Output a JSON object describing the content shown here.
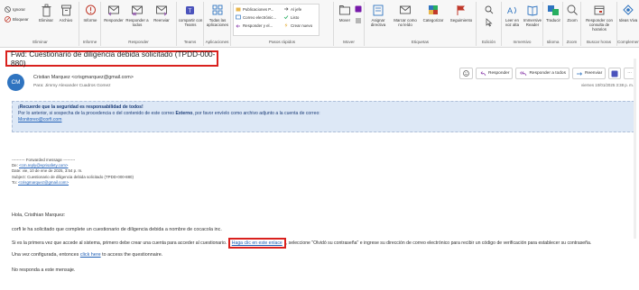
{
  "ribbon": {
    "groups": [
      {
        "label": "Eliminar",
        "buttons": [
          "Ignorar",
          "Bloquear",
          "Eliminar",
          "Archivo"
        ]
      },
      {
        "label": "Informe",
        "buttons": [
          "Informe"
        ]
      },
      {
        "label": "Responder",
        "buttons": [
          "Responder",
          "Responder a todos",
          "Reenviar"
        ]
      },
      {
        "label": "Teams",
        "buttons": [
          "compartir con Teams"
        ]
      },
      {
        "label": "Aplicaciones",
        "buttons": [
          "Todas las aplicaciones"
        ]
      },
      {
        "label": "Pasos rápidos",
        "buttons": [
          "Publicaciones P...",
          "Correo electrónic...",
          "Responder y el...",
          "Al jefe",
          "Listo",
          "Crear nuevo"
        ]
      },
      {
        "label": "Mover",
        "buttons": [
          "Mover"
        ]
      },
      {
        "label": "Etiquetas",
        "buttons": [
          "Asignar directiva",
          "Marcar como no leído",
          "Categorizar",
          "Seguimiento"
        ]
      },
      {
        "label": "Edición",
        "buttons": []
      },
      {
        "label": "Inmersivo",
        "buttons": [
          "Leer en voz alta",
          "Immersive Reader"
        ]
      },
      {
        "label": "Idioma",
        "buttons": [
          "Traducir"
        ]
      },
      {
        "label": "Zoom",
        "buttons": [
          "Zoom"
        ]
      },
      {
        "label": "Buscar horas",
        "buttons": [
          "Responder con consulta de horarios"
        ]
      },
      {
        "label": "Complemento",
        "buttons": [
          "Ideas Viva"
        ]
      }
    ]
  },
  "email": {
    "subject": "Fwd: Cuestionario de diligencia debida solicitado (TPDD-000-880)",
    "avatar_initials": "CM",
    "from": "Cristian Marquez <crisgmarquez@gmail.com>",
    "to": "Para: Jimmy Alexander Cuadros Gomez",
    "date": "viernes 10/01/2025 3:38 p. m.",
    "actions": {
      "reply": "Responder",
      "reply_all": "Responder a todos",
      "forward": "Reenviar"
    },
    "banner": {
      "line1": "¡Recuerde que la seguridad es responsabilidad de todos!",
      "line2_pre": "Por lo anterior, si sospecha de la procedencia o del contenido de este correo ",
      "line2_bold": "Externo",
      "line2_post": ", por favor envíelo como archivo adjunto a la cuenta de correo:",
      "link": "Monitoreo@corfi.com"
    },
    "forwarded": {
      "header": "---------- Forwarded message ---------",
      "from_label": "De: ",
      "from_value": "<cm.reply@eprisafety.com>",
      "date_line": "Date: vie, 10 de ene de 2025, 3:54 p. m.",
      "subject_line": "Subject: Cuestionario de diligencia debida solicitado (TPDD-000-880)",
      "to_label": "To: ",
      "to_value": "<crisgmarquez@gmail.com>"
    },
    "greeting": "Hola, Cristhian Marquez:",
    "para1": "corfi le ha solicitado que complete un cuestionario de diligencia debida a nombre de cocacola inc.",
    "para2_pre": "Si es la primera vez que accede al sistema, primero debe crear una cuenta para acceder al cuestionario.",
    "para2_link": "Haga clic en este enlace",
    "para2_post": ", seleccione \"Olvidó su contraseña\" e ingrese su dirección de correo electrónico para recibir un código de verificación para establecer su contraseña.",
    "para3_pre": "Una vez configurada, entonces ",
    "para3_link": "click here",
    "para3_post": " to access the questionnaire.",
    "closing": "No responda a este mensaje."
  },
  "colors": {
    "accent": "#2f74c0",
    "highlight": "#d9211e",
    "banner": "#dde8f6",
    "link": "#1f5fb6"
  }
}
